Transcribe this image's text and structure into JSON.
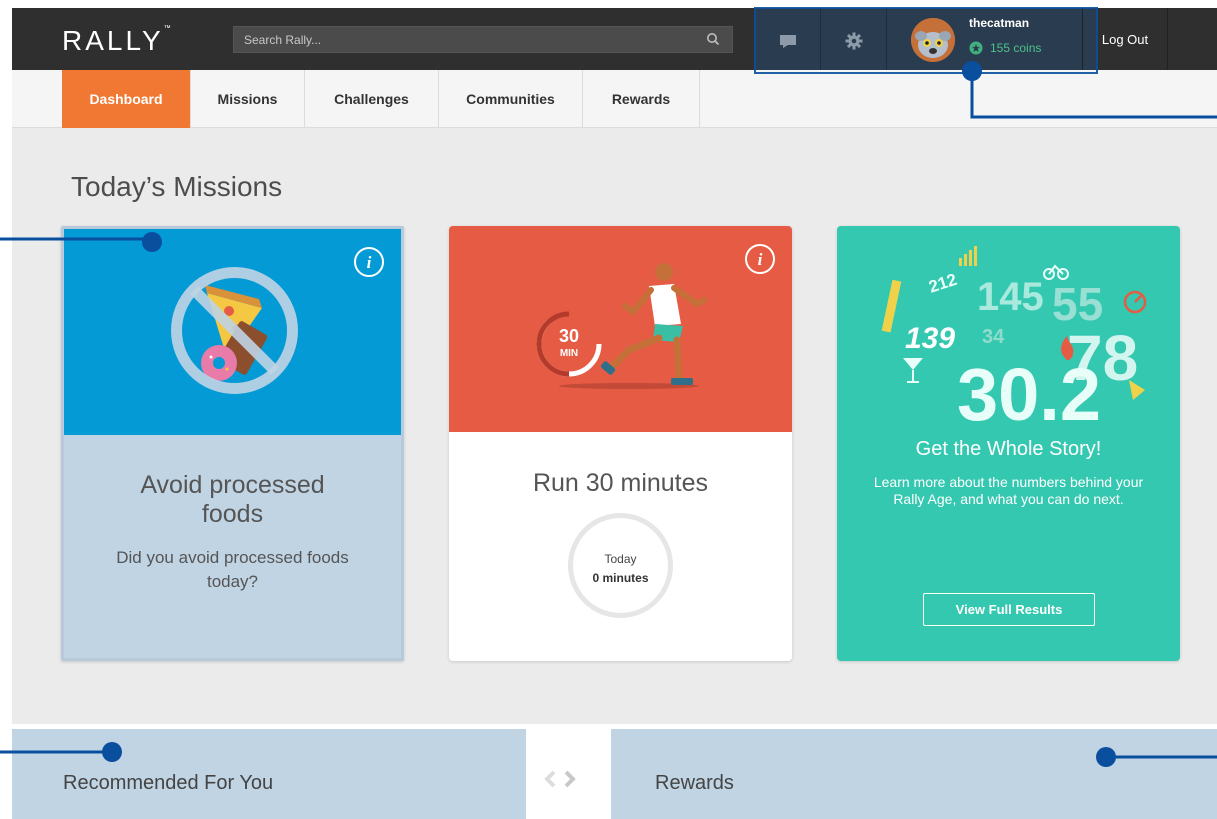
{
  "header": {
    "logo": "RALLY",
    "logo_tm": "™",
    "search_placeholder": "Search Rally...",
    "username": "thecatman",
    "coins": "155 coins",
    "logout": "Log Out"
  },
  "nav": {
    "tabs": [
      {
        "label": "Dashboard",
        "active": true
      },
      {
        "label": "Missions"
      },
      {
        "label": "Challenges"
      },
      {
        "label": "Communities"
      },
      {
        "label": "Rewards"
      }
    ]
  },
  "main": {
    "section_title": "Today’s Missions",
    "cards": [
      {
        "title": "Avoid processed foods",
        "question": "Did you avoid processed foods today?"
      },
      {
        "title": "Run 30 minutes",
        "badge_number": "30",
        "badge_unit": "MIN",
        "timer_label": "Today",
        "timer_value": "0 minutes"
      },
      {
        "stats": [
          "212",
          "145",
          "55",
          "139",
          "34",
          "78",
          "30.2"
        ],
        "title": "Get the Whole Story!",
        "text": "Learn more about the numbers behind your Rally Age, and what you can do next.",
        "button": "View Full Results"
      }
    ]
  },
  "bottom": {
    "recommended": "Recommended For You",
    "rewards": "Rewards"
  },
  "colors": {
    "topbar": "#2f2f2f",
    "active_tab": "#f07832",
    "blue_card": "#039ad6",
    "red_card": "#e65b44",
    "teal_card": "#35c8b0",
    "highlight": "#c0d4e4",
    "annotation": "#0a4f9e"
  }
}
